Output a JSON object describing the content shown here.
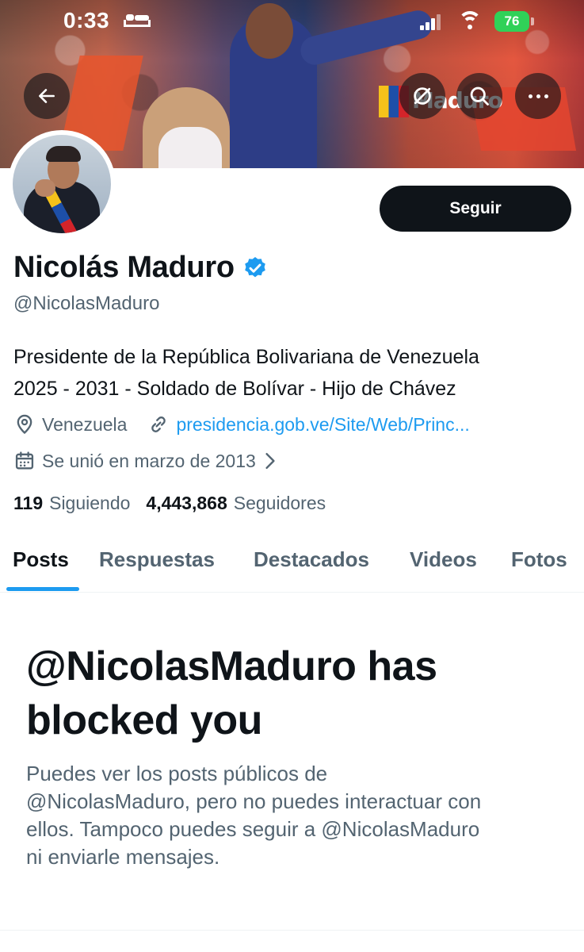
{
  "status_bar": {
    "time": "0:33",
    "battery_percent": "76",
    "battery_color": "#30d158"
  },
  "banner": {
    "logo_text": "Maduro"
  },
  "header_buttons": {
    "back_icon": "arrow-left-icon",
    "mute_icon": "mute-icon",
    "search_icon": "search-icon",
    "more_icon": "more-horizontal-icon"
  },
  "profile": {
    "name": "Nicolás Maduro",
    "verified": true,
    "verified_color": "#1d9bf0",
    "handle": "@NicolasMaduro",
    "bio_line1": "Presidente de la República Bolivariana de Venezuela",
    "bio_line2": "2025 - 2031 - Soldado de Bolívar - Hijo de Chávez",
    "location": "Venezuela",
    "website": "presidencia.gob.ve/Site/Web/Princ...",
    "joined": "Se unió en marzo de 2013",
    "following_count": "119",
    "following_label": "Siguiendo",
    "followers_count": "4,443,868",
    "followers_label": "Seguidores",
    "follow_button_label": "Seguir"
  },
  "tabs": [
    {
      "label": "Posts",
      "active": true
    },
    {
      "label": "Respuestas",
      "active": false
    },
    {
      "label": "Destacados",
      "active": false
    },
    {
      "label": "Videos",
      "active": false
    },
    {
      "label": "Fotos",
      "active": false
    }
  ],
  "blocked_notice": {
    "title_line1": "@NicolasMaduro has",
    "title_line2": "blocked you",
    "body_line1": "Puedes ver los posts públicos de",
    "body_line2": "@NicolasMaduro, pero no puedes interactuar con",
    "body_line3": "ellos. Tampoco puedes seguir a @NicolasMaduro",
    "body_line4": "ni enviarle mensajes."
  },
  "colors": {
    "text_primary": "#0f1419",
    "text_secondary": "#536471",
    "accent": "#1d9bf0"
  }
}
